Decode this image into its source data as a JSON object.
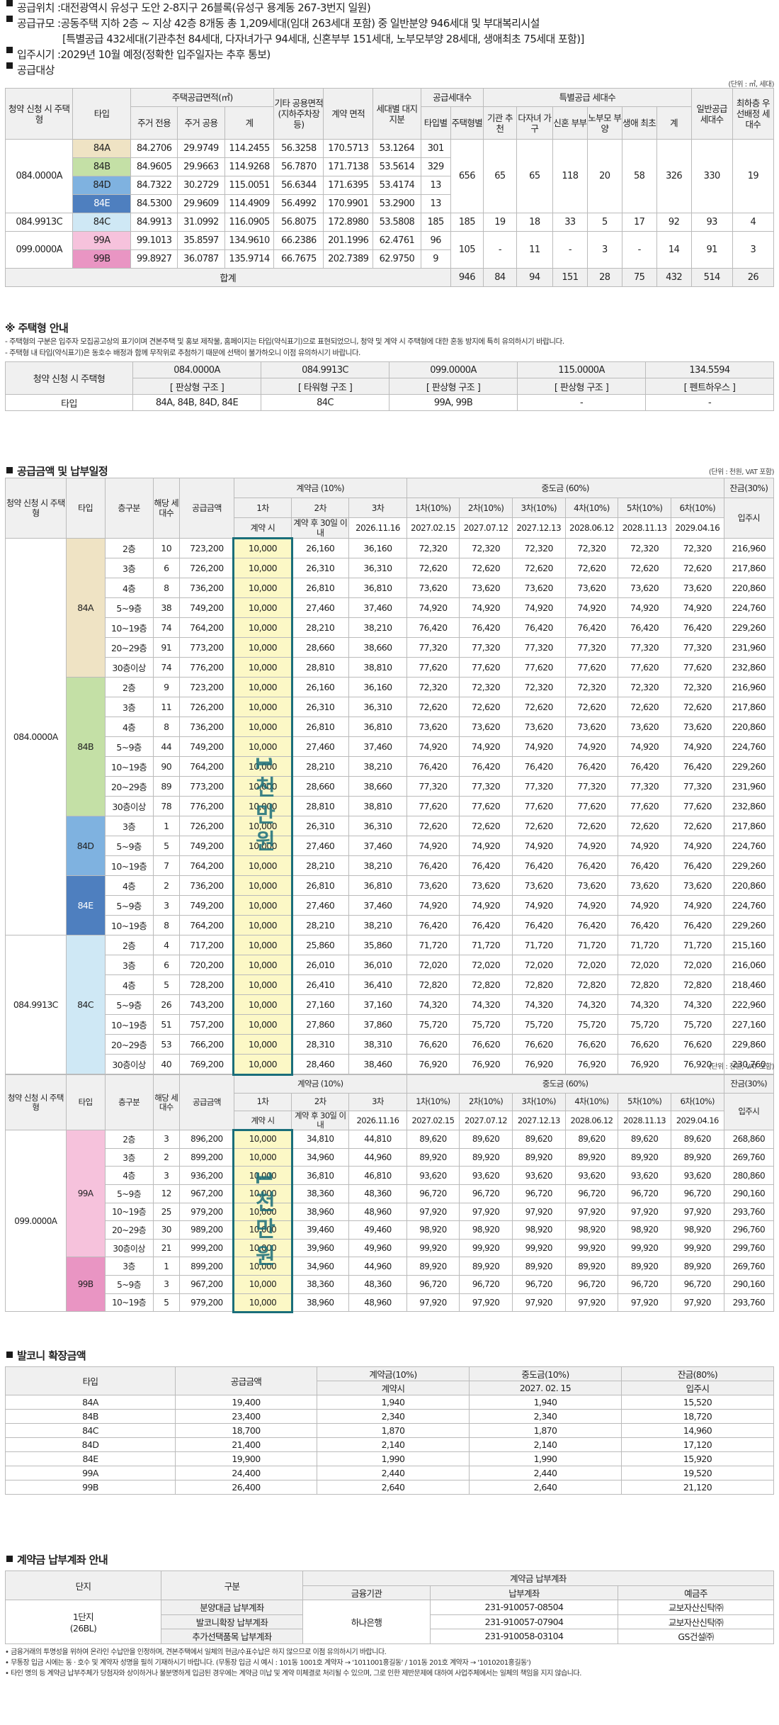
{
  "header": {
    "l1_label": "공급위치 : ",
    "l1_value": "대전광역시 유성구 도안 2-8지구 26블록(유성구 용계동 267-3번지 일원)",
    "l2_label": "공급규모 : ",
    "l2_value": "공동주택 지하 2층 ~ 지상 42층 8개동 총 1,209세대(임대 263세대 포함) 중 일반분양 946세대 및 부대복리시설",
    "l3_value": "[특별공급 432세대(기관추천 84세대, 다자녀가구 94세대, 신혼부부 151세대, 노부모부양 28세대, 생애최초 75세대 포함)]",
    "l4_label": "입주시기 : ",
    "l4_value": "2029년 10월 예정(정확한 입주일자는 추후 통보)",
    "l5_label": "공급대상"
  },
  "supply": {
    "unit": "(단위 : ㎡, 세대)",
    "h": {
      "type_no": "청약 신청 시 주택형",
      "type": "타입",
      "area": "주택공급면적(㎡)",
      "resident_excl": "주거 전용",
      "resident_common": "주거 공용",
      "sum": "계",
      "other": "기타 공용면적 (지하주차장 등)",
      "contract": "계약 면적",
      "land": "세대별 대지지분",
      "supply_units": "공급세대수",
      "by_type": "타입별",
      "by_house": "주택형별",
      "special": "특별공급 세대수",
      "inst": "기관 추천",
      "multi": "다자녀 가구",
      "newly": "신혼 부부",
      "elder": "노부모 부양",
      "first": "생애 최초",
      "total": "계",
      "general": "일반공급 세대수",
      "min_pri": "최하층 우선배정 세대수"
    },
    "rows": [
      {
        "type_no": "084.0000A",
        "type": "84A",
        "v": [
          "84.2706",
          "29.9749",
          "114.2455",
          "56.3258",
          "170.5713",
          "53.1264",
          "301"
        ]
      },
      {
        "type": "84B",
        "v": [
          "84.9605",
          "29.9663",
          "114.9268",
          "56.7870",
          "171.7138",
          "53.5614",
          "329"
        ]
      },
      {
        "type": "84D",
        "v": [
          "84.7322",
          "30.2729",
          "115.0051",
          "56.6344",
          "171.6395",
          "53.4174",
          "13"
        ]
      },
      {
        "type": "84E",
        "v": [
          "84.5300",
          "29.9609",
          "114.4909",
          "56.4992",
          "170.9901",
          "53.2900",
          "13"
        ]
      },
      {
        "type_no": "084.9913C",
        "type": "84C",
        "v": [
          "84.9913",
          "31.0992",
          "116.0905",
          "56.8075",
          "172.8980",
          "53.5808",
          "185"
        ]
      },
      {
        "type_no": "099.0000A",
        "type": "99A",
        "v": [
          "99.1013",
          "35.8597",
          "134.9610",
          "66.2386",
          "201.1996",
          "62.4761",
          "96"
        ]
      },
      {
        "type": "99B",
        "v": [
          "99.8927",
          "36.0787",
          "135.9714",
          "66.7675",
          "202.7389",
          "62.9750",
          "9"
        ]
      }
    ],
    "g84": [
      "656",
      "65",
      "65",
      "118",
      "20",
      "58",
      "326",
      "330",
      "19"
    ],
    "g84c": [
      "185",
      "19",
      "18",
      "33",
      "5",
      "17",
      "92",
      "93",
      "4"
    ],
    "g99": [
      "105",
      "-",
      "11",
      "-",
      "3",
      "-",
      "14",
      "91",
      "3"
    ],
    "total_label": "합계",
    "total": [
      "946",
      "84",
      "94",
      "151",
      "28",
      "75",
      "432",
      "514",
      "26"
    ]
  },
  "guide": {
    "title": "※ 주택형 안내",
    "n1": "- 주택형의 구분은 입주자 모집공고상의 표기이며 견본주택 및 홍보 제작물, 홈페이지는 타입(약식표기)으로 표현되었으니, 청약 및 계약 시 주택형에 대한 혼동 방지에 특히 유의하시기 바랍니다.",
    "n2": "- 주택형 내 타입(약식표기)은 동호수 배정과 함께 무작위로 추첨하기 때문에 선택이 불가하오니 이점 유의하시기 바랍니다.",
    "h_type_no": "청약 신청 시 주택형",
    "h_type": "타입",
    "cols": [
      {
        "no": "084.0000A",
        "struct": "[ 판상형 구조 ]",
        "types": "84A, 84B, 84D, 84E"
      },
      {
        "no": "084.9913C",
        "struct": "[ 타워형 구조 ]",
        "types": "84C"
      },
      {
        "no": "099.0000A",
        "struct": "[ 판상형 구조 ]",
        "types": "99A, 99B"
      },
      {
        "no": "115.0000A",
        "struct": "[ 판상형 구조 ]",
        "types": "-"
      },
      {
        "no": "134.5594",
        "struct": "[ 펜트하우스 ]",
        "types": "-"
      }
    ]
  },
  "price": {
    "title": "공급금액 및 납부일정",
    "unit": "(단위 : 천원, VAT 포함)",
    "h": {
      "type_no": "청약 신청 시 주택형",
      "type": "타입",
      "floor": "층구분",
      "units": "해당 세대수",
      "amount": "공급금액",
      "deposit": "계약금 (10%)",
      "d1": "1차",
      "d2": "2차",
      "d3": "3차",
      "d1s": "계약 시",
      "d2s": "계약 후 30일 이내",
      "d3s": "2026.11.16",
      "mid": "중도금 (60%)",
      "m1": "1차(10%)",
      "m2": "2차(10%)",
      "m3": "3차(10%)",
      "m4": "4차(10%)",
      "m5": "5차(10%)",
      "m6": "6차(10%)",
      "m1s": "2027.02.15",
      "m2s": "2027.07.12",
      "m3s": "2027.12.13",
      "m4s": "2028.06.12",
      "m5s": "2028.11.13",
      "m6s": "2029.04.16",
      "bal": "잔금(30%)",
      "bals": "입주시"
    },
    "stamp": "1천만원",
    "t84": [
      {
        "g": "084.0000A",
        "t": "84A",
        "f": "2층",
        "n": "10",
        "a": "723,200",
        "d1": "10,000",
        "d2": "26,160",
        "d3": "36,160",
        "m": "72,320",
        "b": "216,960"
      },
      {
        "f": "3층",
        "n": "6",
        "a": "726,200",
        "d1": "10,000",
        "d2": "26,310",
        "d3": "36,310",
        "m": "72,620",
        "b": "217,860"
      },
      {
        "f": "4층",
        "n": "8",
        "a": "736,200",
        "d1": "10,000",
        "d2": "26,810",
        "d3": "36,810",
        "m": "73,620",
        "b": "220,860"
      },
      {
        "f": "5~9층",
        "n": "38",
        "a": "749,200",
        "d1": "10,000",
        "d2": "27,460",
        "d3": "37,460",
        "m": "74,920",
        "b": "224,760"
      },
      {
        "f": "10~19층",
        "n": "74",
        "a": "764,200",
        "d1": "10,000",
        "d2": "28,210",
        "d3": "38,210",
        "m": "76,420",
        "b": "229,260"
      },
      {
        "f": "20~29층",
        "n": "91",
        "a": "773,200",
        "d1": "10,000",
        "d2": "28,660",
        "d3": "38,660",
        "m": "77,320",
        "b": "231,960"
      },
      {
        "f": "30층이상",
        "n": "74",
        "a": "776,200",
        "d1": "10,000",
        "d2": "28,810",
        "d3": "38,810",
        "m": "77,620",
        "b": "232,860"
      },
      {
        "t": "84B",
        "f": "2층",
        "n": "9",
        "a": "723,200",
        "d1": "10,000",
        "d2": "26,160",
        "d3": "36,160",
        "m": "72,320",
        "b": "216,960"
      },
      {
        "f": "3층",
        "n": "11",
        "a": "726,200",
        "d1": "10,000",
        "d2": "26,310",
        "d3": "36,310",
        "m": "72,620",
        "b": "217,860"
      },
      {
        "f": "4층",
        "n": "8",
        "a": "736,200",
        "d1": "10,000",
        "d2": "26,810",
        "d3": "36,810",
        "m": "73,620",
        "b": "220,860"
      },
      {
        "f": "5~9층",
        "n": "44",
        "a": "749,200",
        "d1": "10,000",
        "d2": "27,460",
        "d3": "37,460",
        "m": "74,920",
        "b": "224,760"
      },
      {
        "f": "10~19층",
        "n": "90",
        "a": "764,200",
        "d1": "10,000",
        "d2": "28,210",
        "d3": "38,210",
        "m": "76,420",
        "b": "229,260"
      },
      {
        "f": "20~29층",
        "n": "89",
        "a": "773,200",
        "d1": "10,000",
        "d2": "28,660",
        "d3": "38,660",
        "m": "77,320",
        "b": "231,960"
      },
      {
        "f": "30층이상",
        "n": "78",
        "a": "776,200",
        "d1": "10,000",
        "d2": "28,810",
        "d3": "38,810",
        "m": "77,620",
        "b": "232,860"
      },
      {
        "t": "84D",
        "f": "3층",
        "n": "1",
        "a": "726,200",
        "d1": "10,000",
        "d2": "26,310",
        "d3": "36,310",
        "m": "72,620",
        "b": "217,860"
      },
      {
        "f": "5~9층",
        "n": "5",
        "a": "749,200",
        "d1": "10,000",
        "d2": "27,460",
        "d3": "37,460",
        "m": "74,920",
        "b": "224,760"
      },
      {
        "f": "10~19층",
        "n": "7",
        "a": "764,200",
        "d1": "10,000",
        "d2": "28,210",
        "d3": "38,210",
        "m": "76,420",
        "b": "229,260"
      },
      {
        "t": "84E",
        "f": "4층",
        "n": "2",
        "a": "736,200",
        "d1": "10,000",
        "d2": "26,810",
        "d3": "36,810",
        "m": "73,620",
        "b": "220,860"
      },
      {
        "f": "5~9층",
        "n": "3",
        "a": "749,200",
        "d1": "10,000",
        "d2": "27,460",
        "d3": "37,460",
        "m": "74,920",
        "b": "224,760"
      },
      {
        "f": "10~19층",
        "n": "8",
        "a": "764,200",
        "d1": "10,000",
        "d2": "28,210",
        "d3": "38,210",
        "m": "76,420",
        "b": "229,260"
      },
      {
        "g": "084.9913C",
        "t": "84C",
        "f": "2층",
        "n": "4",
        "a": "717,200",
        "d1": "10,000",
        "d2": "25,860",
        "d3": "35,860",
        "m": "71,720",
        "b": "215,160"
      },
      {
        "f": "3층",
        "n": "6",
        "a": "720,200",
        "d1": "10,000",
        "d2": "26,010",
        "d3": "36,010",
        "m": "72,020",
        "b": "216,060"
      },
      {
        "f": "4층",
        "n": "5",
        "a": "728,200",
        "d1": "10,000",
        "d2": "26,410",
        "d3": "36,410",
        "m": "72,820",
        "b": "218,460"
      },
      {
        "f": "5~9층",
        "n": "26",
        "a": "743,200",
        "d1": "10,000",
        "d2": "27,160",
        "d3": "37,160",
        "m": "74,320",
        "b": "222,960"
      },
      {
        "f": "10~19층",
        "n": "51",
        "a": "757,200",
        "d1": "10,000",
        "d2": "27,860",
        "d3": "37,860",
        "m": "75,720",
        "b": "227,160"
      },
      {
        "f": "20~29층",
        "n": "53",
        "a": "766,200",
        "d1": "10,000",
        "d2": "28,310",
        "d3": "38,310",
        "m": "76,620",
        "b": "229,860"
      },
      {
        "f": "30층이상",
        "n": "40",
        "a": "769,200",
        "d1": "10,000",
        "d2": "28,460",
        "d3": "38,460",
        "m": "76,920",
        "b": "230,760"
      }
    ],
    "t99": [
      {
        "g": "099.0000A",
        "t": "99A",
        "f": "2층",
        "n": "3",
        "a": "896,200",
        "d1": "10,000",
        "d2": "34,810",
        "d3": "44,810",
        "m": "89,620",
        "b": "268,860"
      },
      {
        "f": "3층",
        "n": "2",
        "a": "899,200",
        "d1": "10,000",
        "d2": "34,960",
        "d3": "44,960",
        "m": "89,920",
        "b": "269,760"
      },
      {
        "f": "4층",
        "n": "3",
        "a": "936,200",
        "d1": "10,000",
        "d2": "36,810",
        "d3": "46,810",
        "m": "93,620",
        "b": "280,860"
      },
      {
        "f": "5~9층",
        "n": "12",
        "a": "967,200",
        "d1": "10,000",
        "d2": "38,360",
        "d3": "48,360",
        "m": "96,720",
        "b": "290,160"
      },
      {
        "f": "10~19층",
        "n": "25",
        "a": "979,200",
        "d1": "10,000",
        "d2": "38,960",
        "d3": "48,960",
        "m": "97,920",
        "b": "293,760"
      },
      {
        "f": "20~29층",
        "n": "30",
        "a": "989,200",
        "d1": "10,000",
        "d2": "39,460",
        "d3": "49,460",
        "m": "98,920",
        "b": "296,760"
      },
      {
        "f": "30층이상",
        "n": "21",
        "a": "999,200",
        "d1": "10,000",
        "d2": "39,960",
        "d3": "49,960",
        "m": "99,920",
        "b": "299,760"
      },
      {
        "t": "99B",
        "f": "3층",
        "n": "1",
        "a": "899,200",
        "d1": "10,000",
        "d2": "34,960",
        "d3": "44,960",
        "m": "89,920",
        "b": "269,760"
      },
      {
        "f": "5~9층",
        "n": "3",
        "a": "967,200",
        "d1": "10,000",
        "d2": "38,360",
        "d3": "48,360",
        "m": "96,720",
        "b": "290,160"
      },
      {
        "f": "10~19층",
        "n": "5",
        "a": "979,200",
        "d1": "10,000",
        "d2": "38,960",
        "d3": "48,960",
        "m": "97,920",
        "b": "293,760"
      }
    ]
  },
  "balcony": {
    "title": "발코니 확장금액",
    "h": {
      "type": "타입",
      "amount": "공급금액",
      "dep": "계약금(10%)",
      "dep_s": "계약시",
      "mid": "중도금(10%)",
      "mid_s": "2027. 02. 15",
      "bal": "잔금(80%)",
      "bal_s": "입주시"
    },
    "rows": [
      {
        "t": "84A",
        "a": "19,400",
        "d": "1,940",
        "m": "1,940",
        "b": "15,520"
      },
      {
        "t": "84B",
        "a": "23,400",
        "d": "2,340",
        "m": "2,340",
        "b": "18,720"
      },
      {
        "t": "84C",
        "a": "18,700",
        "d": "1,870",
        "m": "1,870",
        "b": "14,960"
      },
      {
        "t": "84D",
        "a": "21,400",
        "d": "2,140",
        "m": "2,140",
        "b": "17,120"
      },
      {
        "t": "84E",
        "a": "19,900",
        "d": "1,990",
        "m": "1,990",
        "b": "15,920"
      },
      {
        "t": "99A",
        "a": "24,400",
        "d": "2,440",
        "m": "2,440",
        "b": "19,520"
      },
      {
        "t": "99B",
        "a": "26,400",
        "d": "2,640",
        "m": "2,640",
        "b": "21,120"
      }
    ]
  },
  "account": {
    "title": "계약금 납부계좌 안내",
    "h": {
      "complex": "단지",
      "kind": "구분",
      "acct": "계약금 납부계좌",
      "bank": "금융기관",
      "no": "납부계좌",
      "holder": "예금주"
    },
    "complex": "1단지 (26BL)",
    "bank": "하나은행",
    "rows": [
      {
        "k": "분양대금 납부계좌",
        "no": "231-910057-08504",
        "h": "교보자산신탁㈜"
      },
      {
        "k": "발코니확장 납부계좌",
        "no": "231-910057-07904",
        "h": "교보자산신탁㈜"
      },
      {
        "k": "추가선택품목 납부계좌",
        "no": "231-910058-03104",
        "h": "GS건설㈜"
      }
    ],
    "n1": "• 금융거래의 투명성을 위하여 온라인 수납만을 인정하며, 견본주택에서 일체의 현금/수표수납은 하지 않으므로 이점 유의하시기 바랍니다.",
    "n2": "• 무통장 입금 시에는 동 · 호수 및 계약자 성명을 필히 기재하시기 바랍니다. (무통장 입금 시 예시 : 101동 1001호 계약자 → '1011001홍길동' / 101동 201호 계약자 → '1010201홍길동')",
    "n3": "• 타인 명의 등 계약금 납부주체가 당첨자와 상이하거나 불분명하게 입금된 경우에는 계약금 미납 및 계약 미체결로 처리될 수 있으며, 그로 인한 제반문제에 대하여 사업주체에서는 일체의 책임을 지지 않습니다."
  }
}
